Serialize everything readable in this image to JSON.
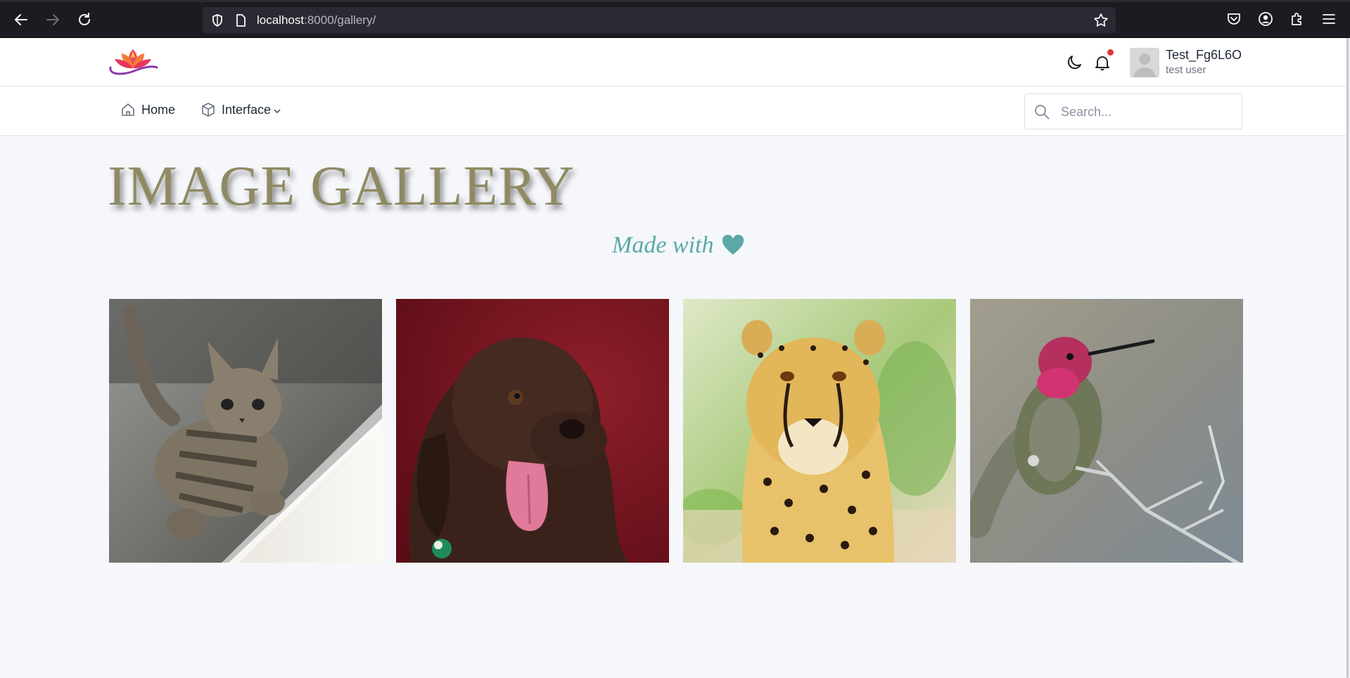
{
  "browser": {
    "url_host": "localhost",
    "url_rest": ":8000/gallery/"
  },
  "header": {
    "user_name": "Test_Fg6L6O",
    "user_role": "test user"
  },
  "nav": {
    "items": [
      {
        "label": "Home",
        "icon": "home-icon"
      },
      {
        "label": "Interface",
        "icon": "cube-icon",
        "has_dropdown": true
      }
    ],
    "search_placeholder": "Search..."
  },
  "gallery": {
    "title": "IMAGE GALLERY",
    "subtitle": "Made with",
    "images": [
      {
        "subject": "kitten"
      },
      {
        "subject": "dog"
      },
      {
        "subject": "cheetah"
      },
      {
        "subject": "hummingbird"
      }
    ]
  },
  "colors": {
    "title": "#8f8a62",
    "subtitle": "#5aa9a6",
    "notification_dot": "#e5333a"
  }
}
